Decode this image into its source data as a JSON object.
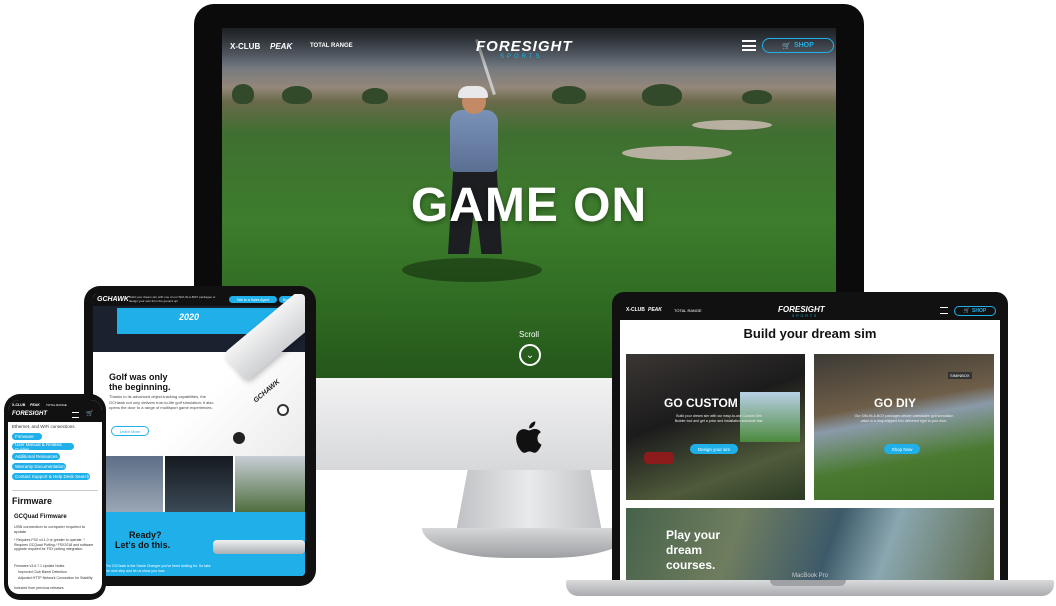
{
  "imac": {
    "nav": {
      "brand_xclub": "X-CLUB",
      "brand_peak": "PEAK",
      "brand_total_range": "TOTAL RANGE",
      "logo_main": "FORESIGHT",
      "logo_sub": "SPORTS",
      "menu_icon": "hamburger-icon",
      "shop_label": "SHOP",
      "shop_icon": "cart-icon"
    },
    "hero": {
      "headline": "GAME ON",
      "scroll_label": "Scroll",
      "scroll_icon": "chevron-down-icon"
    }
  },
  "tablet": {
    "banner": {
      "text": "Build your dream sim with one of our SIM-IN-A-BOX packages or design your own from the ground up!",
      "cta_primary": "Talk to a Sales Agent",
      "cta_secondary": "Buy Now"
    },
    "logo": "GCHAWK",
    "promo_label": "2020",
    "section1": {
      "headline_1": "Golf was only",
      "headline_2": "the beginning.",
      "body": "Thanks to its advanced object-tracking capabilities, the GCHawk not only delivers true-to-life golf simulation; it also opens the door to a range of multisport game experiences.",
      "cta": "Learn More"
    },
    "device_label": "GCHAWK",
    "section2": {
      "headline_1": "Ready?",
      "headline_2": "Let's do this.",
      "body": "The GCHawk is the Game Changer you've been looking for. So take the next step and let us show you how."
    }
  },
  "phone": {
    "nav": {
      "brand_xclub": "X-CLUB",
      "brand_peak": "PEAK",
      "brand_total_range": "TOTAL RANGE",
      "logo": "FORESIGHT"
    },
    "intro_text": "Ethernet, and WiFi connections.",
    "buttons": [
      "Firmware",
      "User Manual & Related Guides",
      "Additional Resources",
      "Warranty Documentation",
      "Contact Support & Help Desk Search"
    ],
    "section_title": "Firmware",
    "subsection_title": "GCQuad Firmware",
    "para1": "USB connection to computer required to update",
    "para2": "* Requires FSX v4.1.0 or greater to operate. * Requires GCQuad Putting / FSX2018 and software upgrade required for FSX putting integration.",
    "notes_title": "Firmware v3.6.7.1 Update Notes",
    "notes": [
      "Improved Club Barrel Detection",
      "Adjusted HTTP Network Connection for Stability",
      "Included from previous releases"
    ]
  },
  "laptop": {
    "nav": {
      "brand_xclub": "X-CLUB",
      "brand_peak": "PEAK",
      "brand_total_range": "TOTAL RANGE",
      "logo_main": "FORESIGHT",
      "logo_sub": "SPORTS",
      "shop_label": "SHOP"
    },
    "heading": "Build your dream sim",
    "cards": [
      {
        "title": "GO CUSTOM",
        "body": "Build your dream sim with our easy-to-use Custom Sim Builder tool and get a price and installation schedule fast.",
        "cta": "Design your sim"
      },
      {
        "title": "GO DIY",
        "body": "Our SIM-IN-A-BOX packages deliver unbeatable golf simulation value in a drop-shipped box delivered right to your door.",
        "cta": "Shop Now"
      }
    ],
    "sign_label": "SIMINBOX",
    "courses": {
      "line1": "Play your",
      "line2": "dream",
      "line3": "courses."
    },
    "model_label": "MacBook Pro"
  },
  "colors": {
    "accent": "#1fb0ea",
    "dark": "#111111"
  }
}
